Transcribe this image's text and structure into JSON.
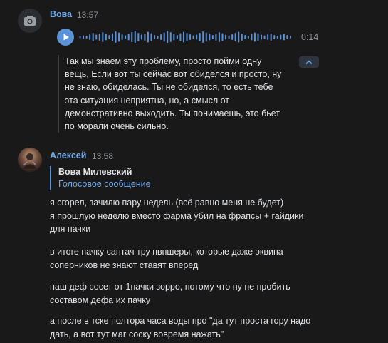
{
  "colors": {
    "background": "#191919",
    "author_link": "#71aaeb",
    "accent": "#5b92d6",
    "text": "#e1e3e6",
    "muted": "#8b8e93"
  },
  "messages": [
    {
      "author": "Вова",
      "time": "13:57",
      "avatar_icon": "camera-icon",
      "voice": {
        "duration": "0:14",
        "play_icon": "play-icon",
        "transcript": "Так мы знаем эту проблему, просто пойми одну\nвещь, Если вот ты сейчас вот обиделся и просто, ну\nне знаю, обиделась. Ты не обиделся, то есть тебе\nэта ситуация неприятна, но, а смысл от\nдемонстративно выходить. Ты понимаешь, это бьет\nпо морали очень сильно.",
        "collapse_icon": "chevron-up-icon"
      }
    },
    {
      "author": "Алексей",
      "time": "13:58",
      "reply": {
        "author": "Вова Милевский",
        "text": "Голосовое сообщение"
      },
      "paragraphs": [
        "я сгорел, зачилю пару недель (всё равно меня не будет)\nя прошлую неделю вместо фарма убил на фрапсы + гайдики\nдля пачки",
        "в итоге пачку сантач тру пвпшеры, которые даже эквипа\nсоперников не знают ставят вперед",
        "наш деф сосет от 1пачки зорро, потому что ну не пробить\nсоставом дефа их пачку",
        "а после в тске полтора часа воды про \"да тут проста гору надо\nдать, а вот тут маг соску вовремя нажать\""
      ]
    }
  ]
}
